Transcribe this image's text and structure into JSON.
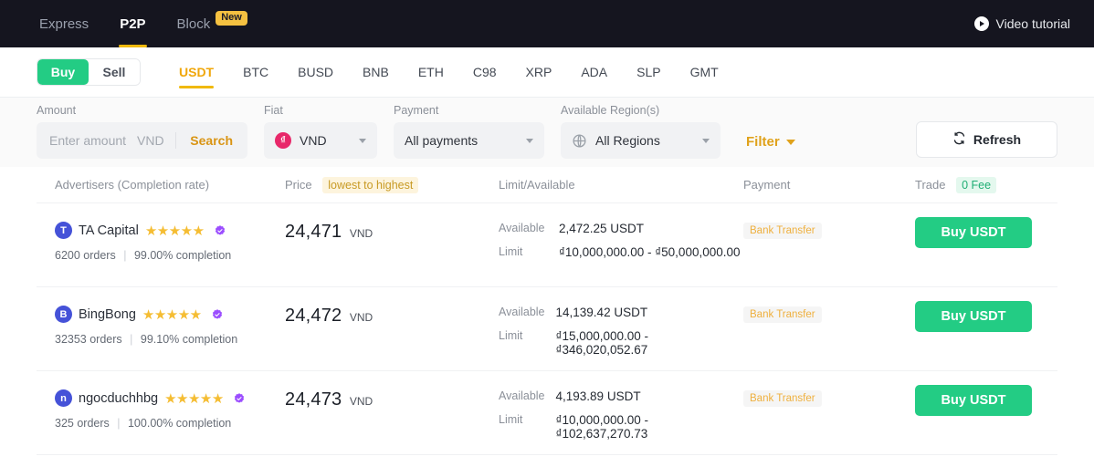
{
  "topnav": {
    "items": [
      {
        "label": "Express",
        "active": false,
        "badge": null
      },
      {
        "label": "P2P",
        "active": true,
        "badge": null
      },
      {
        "label": "Block",
        "active": false,
        "badge": "New"
      }
    ],
    "video_tutorial": "Video tutorial"
  },
  "subnav": {
    "buy_label": "Buy",
    "sell_label": "Sell",
    "coins": [
      "USDT",
      "BTC",
      "BUSD",
      "BNB",
      "ETH",
      "C98",
      "XRP",
      "ADA",
      "SLP",
      "GMT"
    ],
    "active_coin": "USDT"
  },
  "filters": {
    "amount_label": "Amount",
    "amount_value": "",
    "amount_placeholder": "Enter amount",
    "amount_currency": "VND",
    "search_label": "Search",
    "fiat_label": "Fiat",
    "fiat_value": "VND",
    "fiat_symbol": "₫",
    "payment_label": "Payment",
    "payment_value": "All payments",
    "region_label": "Available Region(s)",
    "region_value": "All Regions",
    "filter_label": "Filter",
    "refresh_label": "Refresh"
  },
  "table": {
    "headers": {
      "advertisers": "Advertisers (Completion rate)",
      "price": "Price",
      "price_tag": "lowest to highest",
      "limit": "Limit/Available",
      "payment": "Payment",
      "trade": "Trade",
      "trade_tag": "0 Fee"
    },
    "available_label": "Available",
    "limit_label": "Limit",
    "rows": [
      {
        "avatar_letter": "T",
        "name": "TA Capital",
        "stars": 5,
        "orders": "6200 orders",
        "completion": "99.00% completion",
        "price": "24,471",
        "price_currency": "VND",
        "available": "2,472.25 USDT",
        "limit": "₫10,000,000.00 - ₫50,000,000.00",
        "payment": "Bank Transfer",
        "buy_label": "Buy USDT"
      },
      {
        "avatar_letter": "B",
        "name": "BingBong",
        "stars": 5,
        "orders": "32353 orders",
        "completion": "99.10% completion",
        "price": "24,472",
        "price_currency": "VND",
        "available": "14,139.42 USDT",
        "limit": "₫15,000,000.00 - ₫346,020,052.67",
        "payment": "Bank Transfer",
        "buy_label": "Buy USDT"
      },
      {
        "avatar_letter": "n",
        "name": "ngocduchhbg",
        "stars": 5,
        "orders": "325 orders",
        "completion": "100.00% completion",
        "price": "24,473",
        "price_currency": "VND",
        "available": "4,193.89 USDT",
        "limit": "₫10,000,000.00 - ₫102,637,270.73",
        "payment": "Bank Transfer",
        "buy_label": "Buy USDT"
      }
    ]
  },
  "colors": {
    "accent_yellow": "#f0b90b",
    "buy_green": "#23cc84",
    "nav_dark": "#15151f",
    "star": "#f5bd33",
    "verified_purple": "#9b4dff"
  }
}
